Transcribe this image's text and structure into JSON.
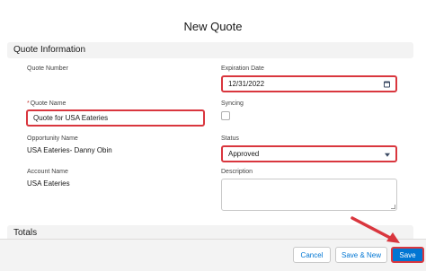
{
  "modal": {
    "title": "New Quote"
  },
  "sections": {
    "quote_information": "Quote Information",
    "totals": "Totals"
  },
  "fields": {
    "quote_number": {
      "label": "Quote Number",
      "value": ""
    },
    "expiration_date": {
      "label": "Expiration Date",
      "value": "12/31/2022"
    },
    "quote_name": {
      "required_mark": "*",
      "label": "Quote Name",
      "value": "Quote for USA Eateries"
    },
    "syncing": {
      "label": "Syncing",
      "checked": false
    },
    "opportunity_name": {
      "label": "Opportunity Name",
      "value": "USA Eateries- Danny Obin"
    },
    "status": {
      "label": "Status",
      "value": "Approved"
    },
    "account_name": {
      "label": "Account Name",
      "value": "USA Eateries"
    },
    "description": {
      "label": "Description",
      "value": ""
    }
  },
  "footer": {
    "cancel_label": "Cancel",
    "save_new_label": "Save & New",
    "save_label": "Save"
  },
  "colors": {
    "brand": "#0176d3",
    "highlight": "#d9363e",
    "section_bg": "#f3f3f3"
  },
  "icons": {
    "date_picker": "calendar-icon",
    "status_dropdown": "chevron-down-icon",
    "annotation": "arrow-icon"
  }
}
